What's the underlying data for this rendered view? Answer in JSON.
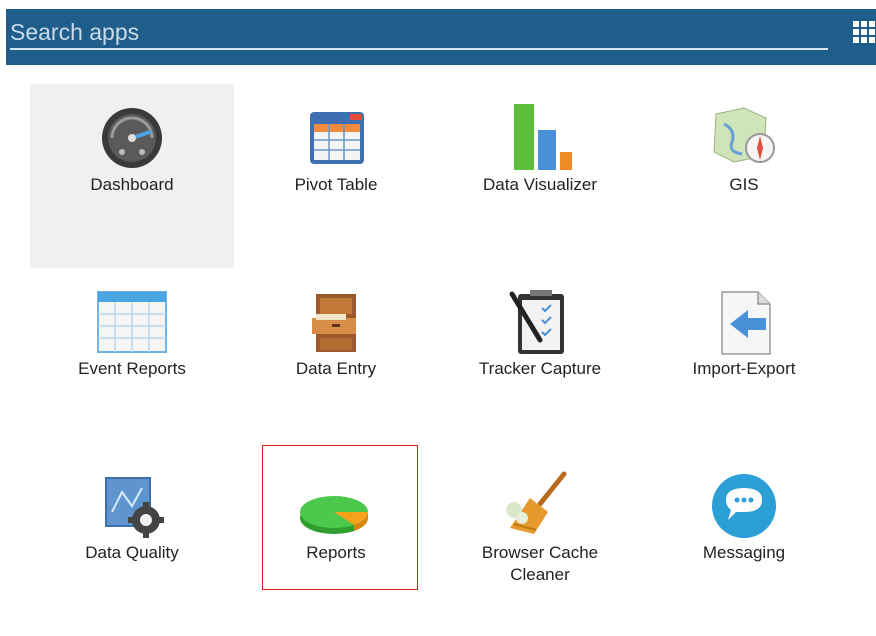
{
  "search": {
    "placeholder": "Search apps",
    "value": ""
  },
  "apps": [
    {
      "label": "Dashboard",
      "icon": "dashboard-icon"
    },
    {
      "label": "Pivot Table",
      "icon": "pivot-table-icon"
    },
    {
      "label": "Data Visualizer",
      "icon": "data-visualizer-icon"
    },
    {
      "label": "GIS",
      "icon": "gis-icon"
    },
    {
      "label": "Event Reports",
      "icon": "event-reports-icon"
    },
    {
      "label": "Data Entry",
      "icon": "data-entry-icon"
    },
    {
      "label": "Tracker Capture",
      "icon": "tracker-capture-icon"
    },
    {
      "label": "Import-Export",
      "icon": "import-export-icon"
    },
    {
      "label": "Data Quality",
      "icon": "data-quality-icon"
    },
    {
      "label": "Reports",
      "icon": "reports-icon"
    },
    {
      "label": "Browser Cache Cleaner",
      "icon": "browser-cache-cleaner-icon"
    },
    {
      "label": "Messaging",
      "icon": "messaging-icon"
    }
  ],
  "colors": {
    "header": "#1f5d8b",
    "highlight": "#e01b1b",
    "active_tile": "#f0f0f0"
  }
}
